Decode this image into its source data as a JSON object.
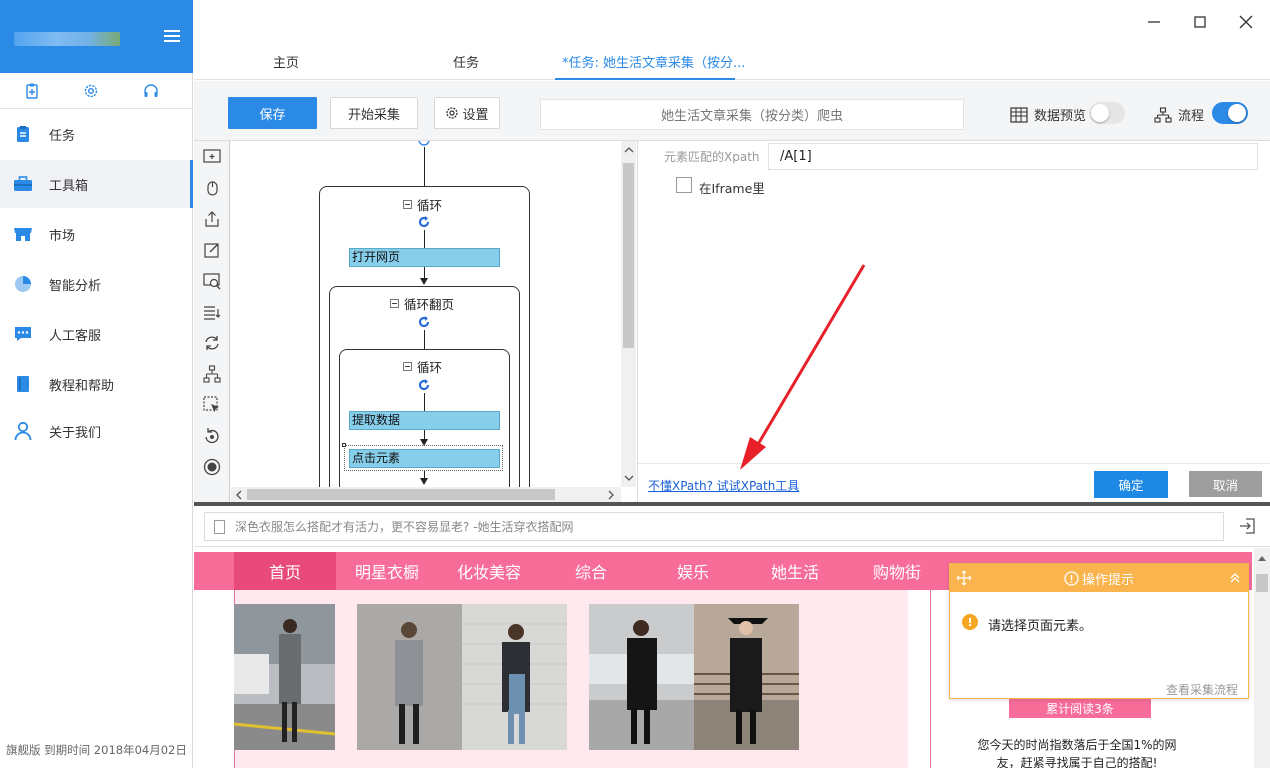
{
  "sidebar": {
    "items": [
      {
        "label": "任务",
        "icon": "clipboard-icon"
      },
      {
        "label": "工具箱",
        "icon": "toolbox-icon"
      },
      {
        "label": "市场",
        "icon": "store-icon"
      },
      {
        "label": "智能分析",
        "icon": "pie-chart-icon"
      },
      {
        "label": "人工客服",
        "icon": "chat-icon"
      },
      {
        "label": "教程和帮助",
        "icon": "book-icon"
      },
      {
        "label": "关于我们",
        "icon": "user-icon"
      }
    ],
    "active": "工具箱",
    "footer": "旗舰版  到期时间  2018年04月02日"
  },
  "tabs": [
    {
      "label": "主页"
    },
    {
      "label": "任务"
    },
    {
      "label": "*任务: 她生活文章采集（按分..."
    }
  ],
  "toolbar": {
    "save_label": "保存",
    "start_label": "开始采集",
    "settings_label": "设置",
    "task_name": "她生活文章采集（按分类）爬虫",
    "preview_label": "数据预览",
    "flow_label": "流程",
    "preview_on": false,
    "flow_on": true
  },
  "flow": {
    "outer_loop": "循环",
    "open_page": "打开网页",
    "paging_loop": "循环翻页",
    "inner_loop": "循环",
    "extract": "提取数据",
    "click": "点击元素"
  },
  "props": {
    "xpath_label": "元素匹配的Xpath",
    "xpath_value": "/A[1]",
    "iframe_label": "在Iframe里",
    "iframe_checked": false,
    "help_link": "不懂XPath?  试试XPath工具",
    "ok_label": "确定",
    "cancel_label": "取消"
  },
  "browser": {
    "url_text": "深色衣服怎么搭配才有活力，更不容易显老? -她生活穿衣搭配网",
    "nav": [
      "首页",
      "明星衣橱",
      "化妆美容",
      "综合",
      "娱乐",
      "她生活",
      "购物街"
    ],
    "read_btn": "累计阅读3条",
    "side_text": "您今天的时尚指数落后于全国1%的网友，赶紧寻找属于自己的搭配!"
  },
  "tip": {
    "title": "操作提示",
    "message": "请选择页面元素。",
    "link": "查看采集流程"
  },
  "colors": {
    "accent": "#2b8ae6",
    "site_pink": "#f76c98",
    "tip_orange": "#f9b44d",
    "annotation_red": "#e8202a"
  }
}
